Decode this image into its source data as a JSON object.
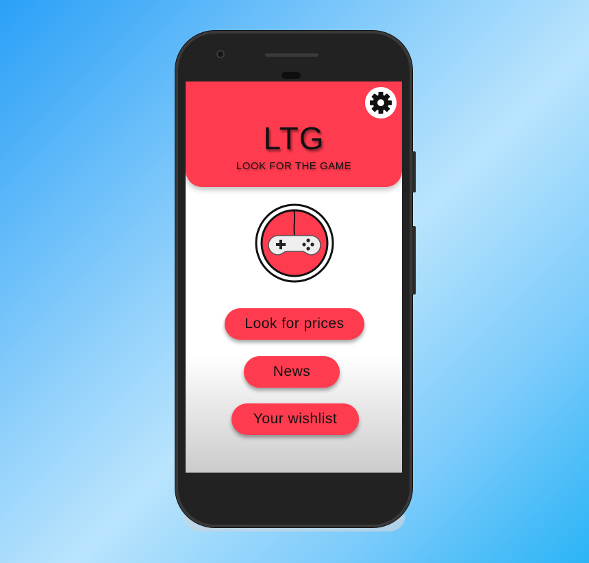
{
  "app": {
    "title": "LTG",
    "subtitle": "LOOK FOR THE GAME"
  },
  "icons": {
    "settings": "gear-icon",
    "logo": "gamepad-icon"
  },
  "menu": {
    "items": [
      {
        "label": "Look for prices"
      },
      {
        "label": "News"
      },
      {
        "label": "Your wishlist"
      }
    ]
  },
  "colors": {
    "accent": "#ff3b4f",
    "text": "#111111",
    "phone_body": "#232223"
  }
}
